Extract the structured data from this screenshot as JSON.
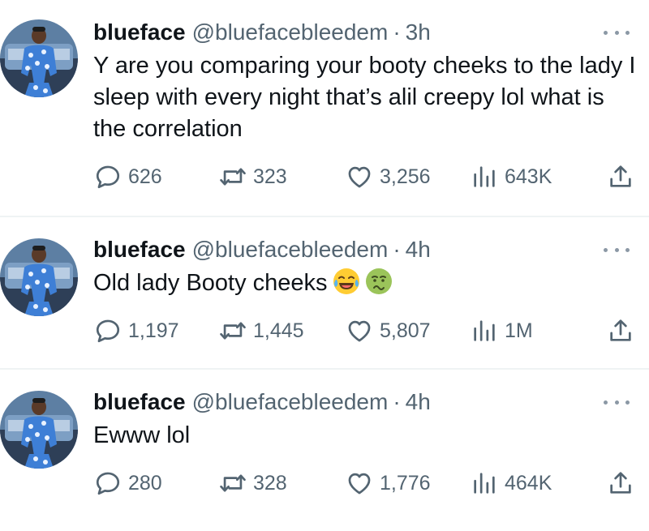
{
  "tweets": [
    {
      "name": "blueface",
      "handle": "@bluefacebleedem",
      "separator": "·",
      "time": "3h",
      "text": "Y are you comparing your booty cheeks to the lady I sleep with every night that’s alil creepy lol what is the correlation",
      "emoji": [],
      "replies": "626",
      "reposts": "323",
      "likes": "3,256",
      "views": "643K"
    },
    {
      "name": "blueface",
      "handle": "@bluefacebleedem",
      "separator": "·",
      "time": "4h",
      "text": "Old lady Booty cheeks",
      "emoji": [
        "face-with-tears-of-joy",
        "nauseated-face"
      ],
      "replies": "1,197",
      "reposts": "1,445",
      "likes": "5,807",
      "views": "1M"
    },
    {
      "name": "blueface",
      "handle": "@bluefacebleedem",
      "separator": "·",
      "time": "4h",
      "text": "Ewww lol",
      "emoji": [],
      "replies": "280",
      "reposts": "328",
      "likes": "1,776",
      "views": "464K"
    }
  ],
  "icons": {
    "reply": "reply-icon",
    "repost": "repost-icon",
    "like": "heart-icon",
    "views": "views-icon",
    "share": "share-icon",
    "more": "more-icon"
  },
  "colors": {
    "text": "#0f1419",
    "secondary": "#536471",
    "divider": "#eff3f4"
  }
}
